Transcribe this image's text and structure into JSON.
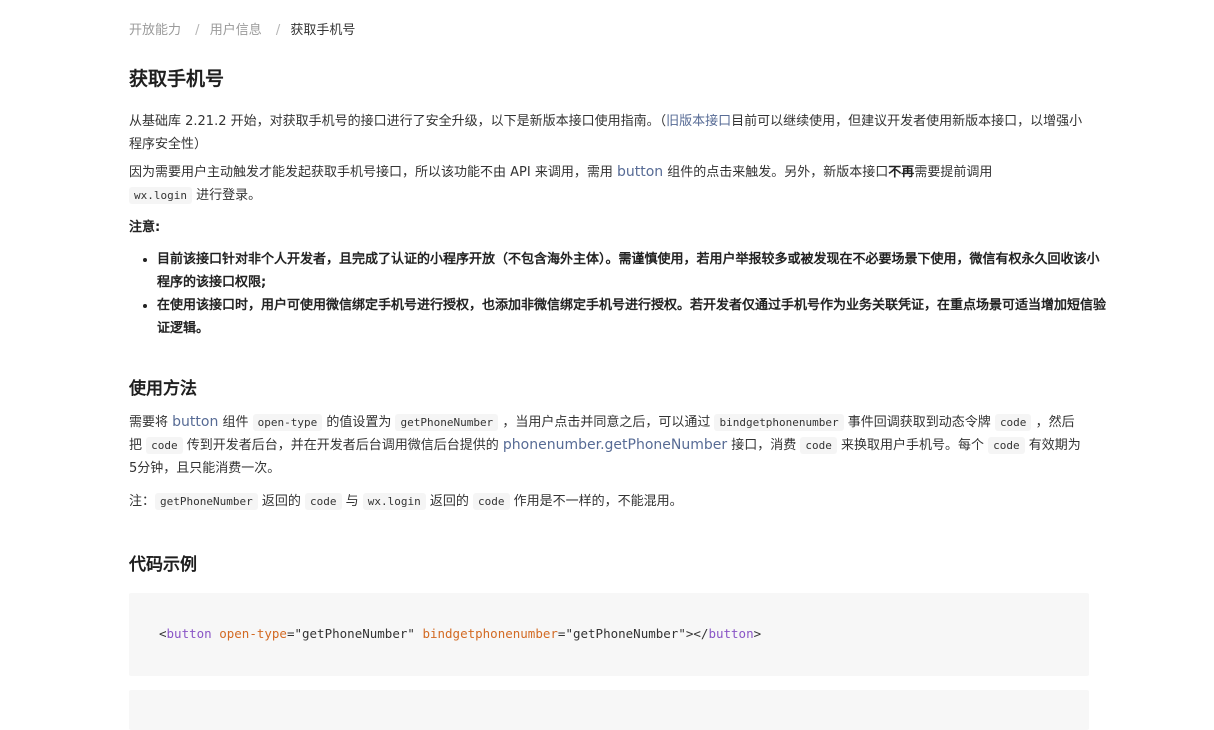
{
  "breadcrumb": {
    "items": [
      "开放能力",
      "用户信息"
    ],
    "current": "获取手机号",
    "separator": "/"
  },
  "title": "获取手机号",
  "intro": {
    "p1_before": "从基础库 2.21.2 开始，对获取手机号的接口进行了安全升级，以下是新版本接口使用指南。（",
    "p1_link": "旧版本接口",
    "p1_after": "目前可以继续使用，但建议开发者使用新版本接口，以增强小程序安全性）",
    "p2_before": "因为需要用户主动触发才能发起获取手机号接口，所以该功能不由 API 来调用，需用 ",
    "p2_link": "button",
    "p2_mid": " 组件的点击来触发。另外，新版本接口",
    "p2_bold": "不再",
    "p2_after": "需要提前调用 ",
    "p2_code": "wx.login",
    "p2_end": " 进行登录。"
  },
  "notice": {
    "label": "注意:",
    "items": [
      "目前该接口针对非个人开发者，且完成了认证的小程序开放（不包含海外主体）。需谨慎使用，若用户举报较多或被发现在不必要场景下使用，微信有权永久回收该小程序的该接口权限;",
      "在使用该接口时，用户可使用微信绑定手机号进行授权，也添加非微信绑定手机号进行授权。若开发者仅通过手机号作为业务关联凭证，在重点场景可适当增加短信验证逻辑。"
    ]
  },
  "usage": {
    "heading": "使用方法",
    "s1": "需要将 ",
    "link_button": "button",
    "s2": " 组件 ",
    "code_opentype": "open-type",
    "s3": " 的值设置为 ",
    "code_getphone": "getPhoneNumber",
    "s4": " ，当用户点击并同意之后，可以通过 ",
    "code_bind": "bindgetphonenumber",
    "s5": " 事件回调获取到动态令牌 ",
    "code_code1": "code",
    "s6": " ，然后把 ",
    "code_code2": "code",
    "s7": " 传到开发者后台，并在开发者后台调用微信后台提供的 ",
    "link_api": "phonenumber.getPhoneNumber",
    "s8": " 接口，消费 ",
    "code_code3": "code",
    "s9": " 来换取用户手机号。每个 ",
    "code_code4": "code",
    "s10": " 有效期为5分钟，且只能消费一次。",
    "note_label": "注：",
    "note_code1": "getPhoneNumber",
    "note_t1": " 返回的 ",
    "note_code2": "code",
    "note_t2": " 与 ",
    "note_code3": "wx.login",
    "note_t3": " 返回的 ",
    "note_code4": "code",
    "note_t4": " 作用是不一样的，不能混用。"
  },
  "code_example": {
    "heading": "代码示例",
    "lt": "<",
    "tag": "button",
    "attr1": "open-type",
    "eq1": "=",
    "val1": "\"getPhoneNumber\"",
    "attr2": "bindgetphonenumber",
    "eq2": "=",
    "val2": "\"getPhoneNumber\"",
    "close_open": "></",
    "close_tag": "button",
    "gt": ">"
  },
  "colors": {
    "link": "#576b95",
    "code_tag": "#8a55c6",
    "code_attr": "#d36a23",
    "code_bg": "#f7f7f7"
  }
}
